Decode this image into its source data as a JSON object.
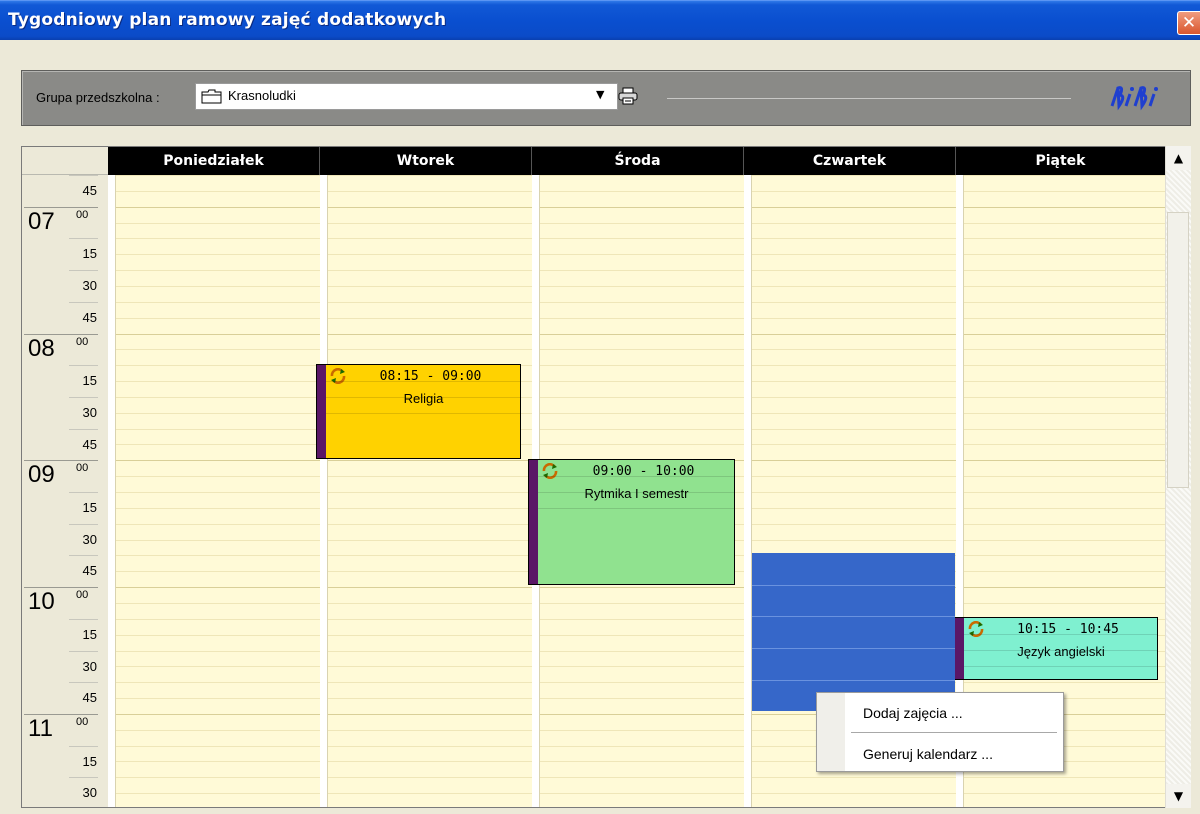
{
  "window": {
    "title": "Tygodniowy plan ramowy zajęć dodatkowych",
    "close_symbol": "✕"
  },
  "toolbar": {
    "group_label": "Grupa przedszkolna :",
    "group_value": "Krasnoludki",
    "dropdown_icon": "chevron-down-icon",
    "print_icon": "printer-icon",
    "logo_icon": "bibi-logo"
  },
  "days": [
    "Poniedziałek",
    "Wtorek",
    "Środa",
    "Czwartek",
    "Piątek"
  ],
  "time_rows": [
    {
      "type": "min",
      "label": "45"
    },
    {
      "type": "hour",
      "hour": "07",
      "min": "00"
    },
    {
      "type": "min",
      "label": "15"
    },
    {
      "type": "min",
      "label": "30"
    },
    {
      "type": "min",
      "label": "45"
    },
    {
      "type": "hour",
      "hour": "08",
      "min": "00"
    },
    {
      "type": "min",
      "label": "15"
    },
    {
      "type": "min",
      "label": "30"
    },
    {
      "type": "min",
      "label": "45"
    },
    {
      "type": "hour",
      "hour": "09",
      "min": "00"
    },
    {
      "type": "min",
      "label": "15"
    },
    {
      "type": "min",
      "label": "30"
    },
    {
      "type": "min",
      "label": "45"
    },
    {
      "type": "hour",
      "hour": "10",
      "min": "00"
    },
    {
      "type": "min",
      "label": "15"
    },
    {
      "type": "min",
      "label": "30"
    },
    {
      "type": "min",
      "label": "45"
    },
    {
      "type": "hour",
      "hour": "11",
      "min": "00"
    },
    {
      "type": "min",
      "label": "15"
    },
    {
      "type": "min",
      "label": "30"
    }
  ],
  "events": [
    {
      "day": "Wtorek",
      "time": "08:15 - 09:00",
      "name": "Religia",
      "color": "#ffd200",
      "icon": "recurring-icon"
    },
    {
      "day": "Środa",
      "time": "09:00 - 10:00",
      "name": "Rytmika I semestr",
      "color": "#90e28f",
      "icon": "recurring-icon"
    },
    {
      "day": "Piątek",
      "time": "10:15 - 10:45",
      "name": "Język angielski",
      "color": "#7ff0d0",
      "icon": "recurring-icon"
    }
  ],
  "context_menu": {
    "add": "Dodaj zajęcia ...",
    "generate": "Generuj kalendarz ..."
  },
  "colors": {
    "grid_bg": "#fffad7",
    "selection": "#3667c9",
    "event_bar": "#5a1766"
  }
}
